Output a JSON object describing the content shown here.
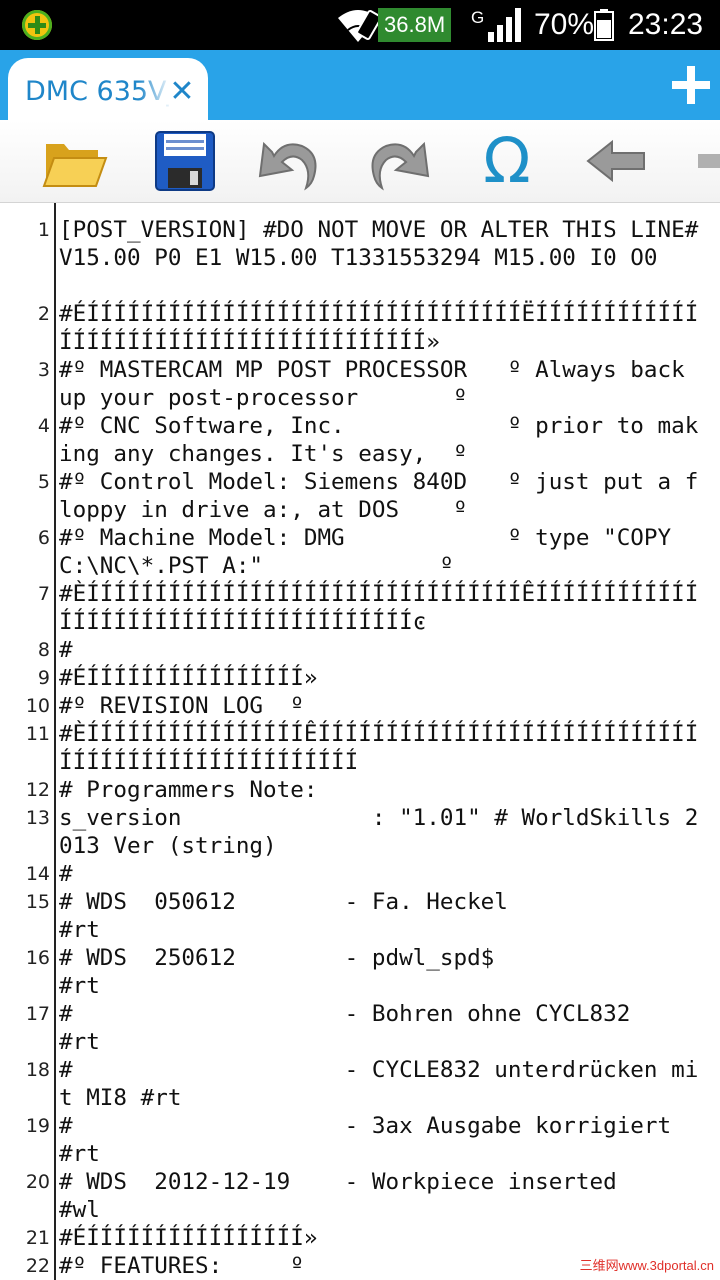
{
  "status_bar": {
    "notification_icon": "clover-plus-icon",
    "wifi_icon": "wifi-icon",
    "net_speed": "36.8M",
    "network_type": "G",
    "signal_icon": "signal-bars-icon",
    "battery_percent": "70%",
    "battery_icon": "battery-icon",
    "time": "23:23"
  },
  "tab_bar": {
    "active_tab_title": "DMC 635V_",
    "close_icon": "close-icon",
    "close_glyph": "✕",
    "add_tab_icon": "plus-icon"
  },
  "toolbar": {
    "buttons": [
      {
        "name": "open-button",
        "icon": "folder-open-icon"
      },
      {
        "name": "save-button",
        "icon": "floppy-save-icon"
      },
      {
        "name": "undo-button",
        "icon": "undo-icon"
      },
      {
        "name": "redo-button",
        "icon": "redo-icon"
      },
      {
        "name": "insert-symbol-button",
        "icon": "omega-icon"
      },
      {
        "name": "back-button",
        "icon": "arrow-left-icon"
      }
    ],
    "omega_glyph": "Ω"
  },
  "editor": {
    "lines": [
      {
        "n": "1",
        "text": "[POST_VERSION] #DO NOT MOVE OR ALTER THIS LINE# V15.00 P0 E1 W15.00 T1331553294 M15.00 I0 O0"
      },
      {
        "n": "2",
        "text": "#ÉÍÍÍÍÍÍÍÍÍÍÍÍÍÍÍÍÍÍÍÍÍÍÍÍÍÍÍÍÍÍÍÍËÍÍÍÍÍÍÍÍÍÍÍÍÍÍÍÍÍÍÍÍÍÍÍÍÍÍÍÍÍÍÍÍÍÍÍÍÍÍÍ»"
      },
      {
        "n": "3",
        "text": "#º MASTERCAM MP POST PROCESSOR   º Always back up your post-processor       º"
      },
      {
        "n": "4",
        "text": "#º CNC Software, Inc.            º prior to making any changes. It's easy,  º"
      },
      {
        "n": "5",
        "text": "#º Control Model: Siemens 840D   º just put a floppy in drive a:, at DOS    º"
      },
      {
        "n": "6",
        "text": "#º Machine Model: DMG            º type \"COPY C:\\NC\\*.PST A:\"             º"
      },
      {
        "n": "7",
        "text": "#ÈÍÍÍÍÍÍÍÍÍÍÍÍÍÍÍÍÍÍÍÍÍÍÍÍÍÍÍÍÍÍÍÍÊÍÍÍÍÍÍÍÍÍÍÍÍÍÍÍÍÍÍÍÍÍÍÍÍÍÍÍÍÍÍÍÍÍÍÍÍÍÍͼ"
      },
      {
        "n": "8",
        "text": "#"
      },
      {
        "n": "9",
        "text": "#ÉÍÍÍÍÍÍÍÍÍÍÍÍÍÍÍÍ»"
      },
      {
        "n": "10",
        "text": "#º REVISION LOG  º"
      },
      {
        "n": "11",
        "text": "#ÈÍÍÍÍÍÍÍÍÍÍÍÍÍÍÍÍÊÍÍÍÍÍÍÍÍÍÍÍÍÍÍÍÍÍÍÍÍÍÍÍÍÍÍÍÍÍÍÍÍÍÍÍÍÍÍÍÍÍÍÍÍÍÍÍÍÍÍ"
      },
      {
        "n": "12",
        "text": "# Programmers Note:"
      },
      {
        "n": "13",
        "text": "s_version              : \"1.01\" # WorldSkills 2013 Ver (string)"
      },
      {
        "n": "14",
        "text": "#"
      },
      {
        "n": "15",
        "text": "# WDS  050612        - Fa. Heckel               #rt"
      },
      {
        "n": "16",
        "text": "# WDS  250612        - pdwl_spd$                #rt"
      },
      {
        "n": "17",
        "text": "#                    - Bohren ohne CYCL832      #rt"
      },
      {
        "n": "18",
        "text": "#                    - CYCLE832 unterdrücken mit MI8 #rt"
      },
      {
        "n": "19",
        "text": "#                    - 3ax Ausgabe korrigiert   #rt"
      },
      {
        "n": "20",
        "text": "# WDS  2012-12-19    - Workpiece inserted       #wl"
      },
      {
        "n": "21",
        "text": "#ÉÍÍÍÍÍÍÍÍÍÍÍÍÍÍÍÍ»"
      },
      {
        "n": "22",
        "text": "#º FEATURES:     º"
      }
    ]
  },
  "watermark": "三维网www.3dportal.cn"
}
